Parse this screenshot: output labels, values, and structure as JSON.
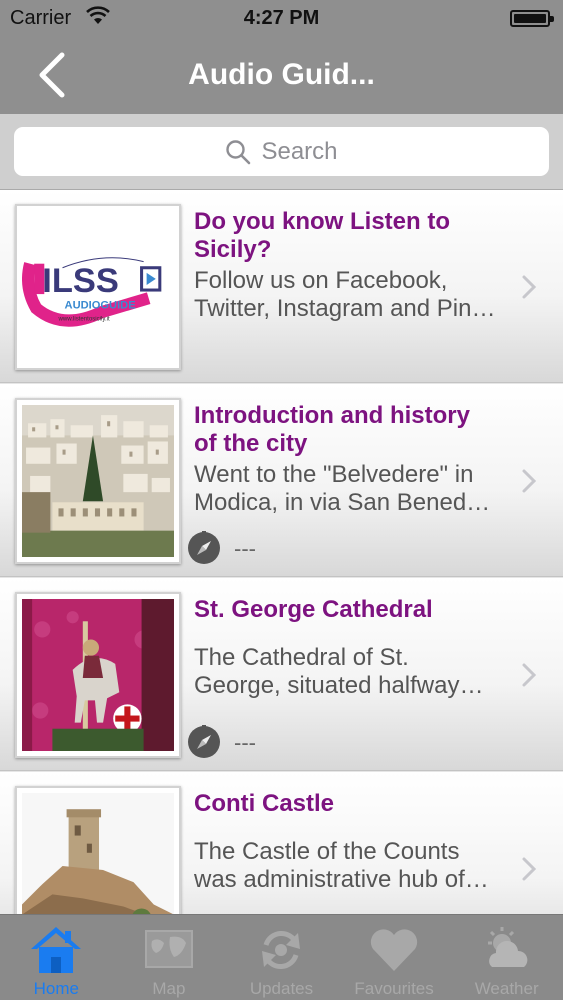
{
  "status_bar": {
    "carrier": "Carrier",
    "time": "4:27 PM"
  },
  "nav": {
    "title": "Audio Guid...",
    "back_icon": "chevron-left-icon"
  },
  "search": {
    "placeholder": "Search",
    "icon": "search-icon"
  },
  "items": [
    {
      "title_line1": "Do you know Listen to",
      "title_line2": "Sicily?",
      "desc_line1": "Follow us on Facebook,",
      "desc_line2": "Twitter, Instagram and Pin…",
      "logo_text": "ILSS",
      "logo_subtext": "AUDIOGUIDE",
      "logo_url": "www.listentosicily.it"
    },
    {
      "title_line1": "Introduction and history",
      "title_line2": "of the city",
      "desc_line1": "Went to the \"Belvedere\" in",
      "desc_line2": "Modica, in via San Bened…",
      "distance": "---"
    },
    {
      "title_line1": "St. George Cathedral",
      "desc_line1": "The Cathedral of St.",
      "desc_line2": "George, situated halfway…",
      "distance": "---"
    },
    {
      "title_line1": "Conti Castle",
      "desc_line1": "The Castle of the Counts",
      "desc_line2": "was administrative hub of…"
    }
  ],
  "tabs": [
    {
      "label": "Home",
      "icon": "home-icon",
      "active": true
    },
    {
      "label": "Map",
      "icon": "map-icon",
      "active": false
    },
    {
      "label": "Updates",
      "icon": "refresh-icon",
      "active": false
    },
    {
      "label": "Favourites",
      "icon": "heart-icon",
      "active": false
    },
    {
      "label": "Weather",
      "icon": "weather-icon",
      "active": false
    }
  ],
  "colors": {
    "accent": "#1a7cf0",
    "title_purple": "#7d1380",
    "bar_gray": "#8f8f8f"
  }
}
